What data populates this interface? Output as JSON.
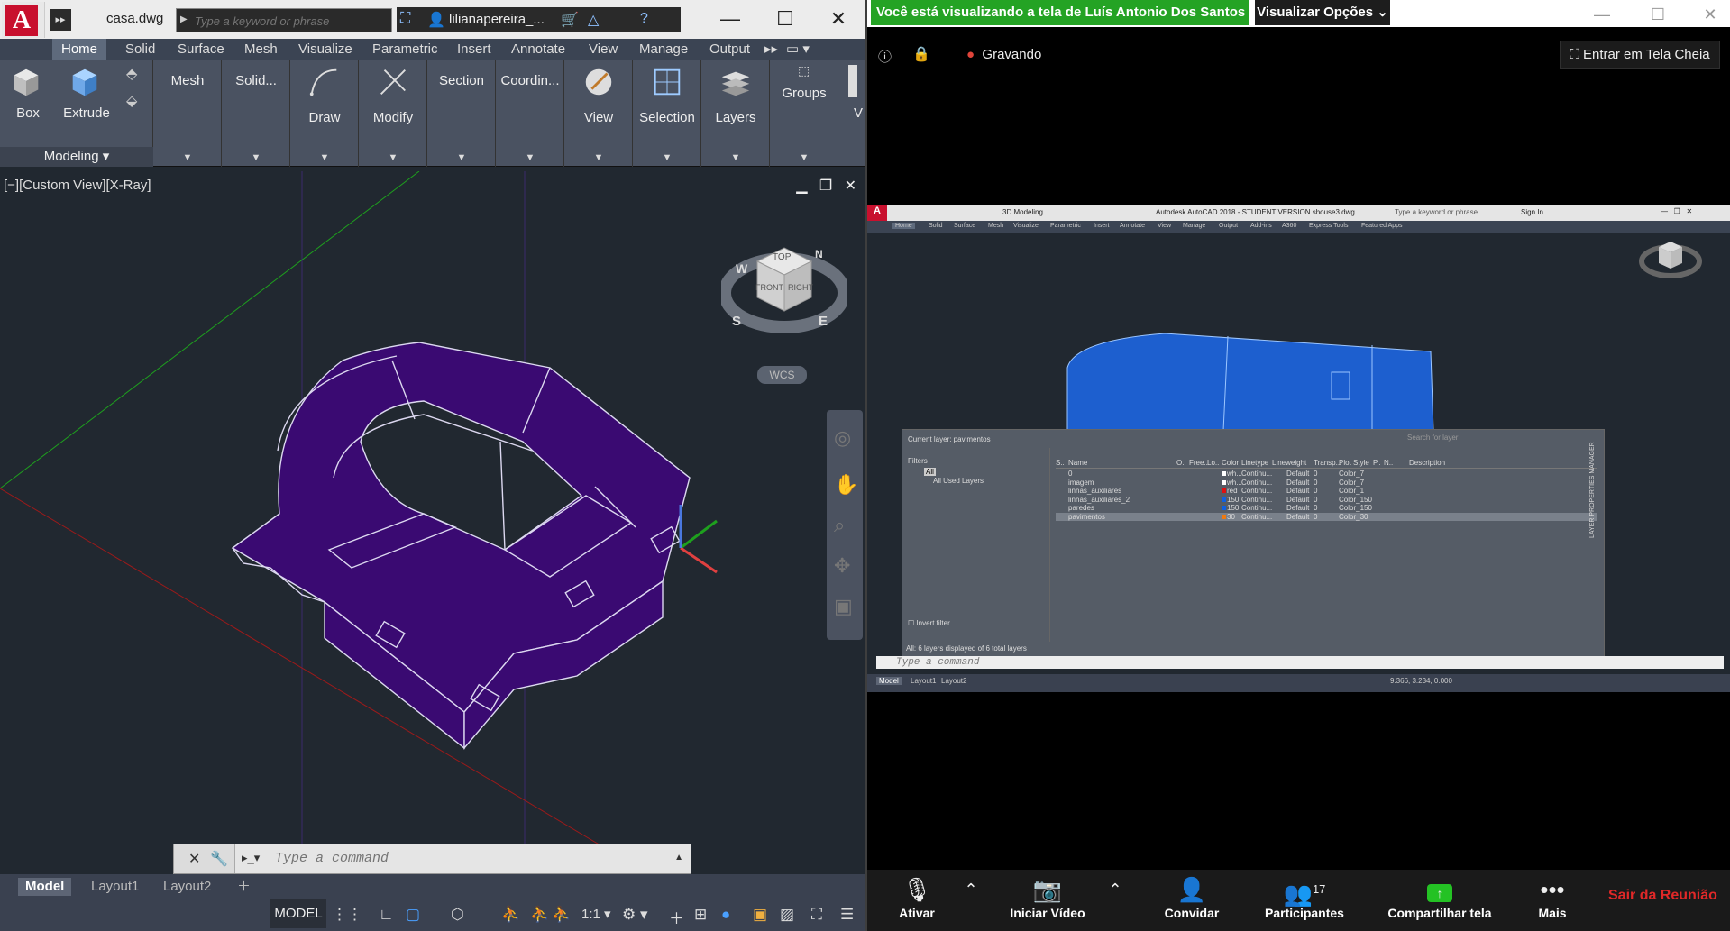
{
  "acad": {
    "file_name": "casa.dwg",
    "search_placeholder": "Type a keyword or phrase",
    "user_name": "lilianapereira_...",
    "tabs": [
      "Home",
      "Solid",
      "Surface",
      "Mesh",
      "Visualize",
      "Parametric",
      "Insert",
      "Annotate",
      "View",
      "Manage",
      "Output"
    ],
    "panels": {
      "box": "Box",
      "extrude": "Extrude",
      "modeling": "Modeling",
      "mesh": "Mesh",
      "solid": "Solid...",
      "draw": "Draw",
      "modify": "Modify",
      "section": "Section",
      "coordin": "Coordin...",
      "view": "View",
      "selection": "Selection",
      "layers": "Layers",
      "groups": "Groups"
    },
    "viewport_label": "[−][Custom View][X-Ray]",
    "viewcube": {
      "top": "TOP",
      "front": "FRONT",
      "right": "RIGHT",
      "compass_w": "W",
      "compass_s": "S",
      "compass_e": "E",
      "compass_n": "N"
    },
    "wcs": "WCS",
    "cmd_placeholder": "Type a command",
    "layout_tabs": [
      "Model",
      "Layout1",
      "Layout2"
    ],
    "status_model": "MODEL",
    "scale": "1:1",
    "model_color": "#3a0a72"
  },
  "zoom": {
    "banner": "Você está visualizando a tela de Luís Antonio Dos Santos o",
    "view_options": "Visualizar Opções",
    "recording": "Gravando",
    "fullscreen": "Entrar em Tela Cheia",
    "toolbar": {
      "mute": "Ativar",
      "video": "Iniciar Vídeo",
      "invite": "Convidar",
      "participants": "Participantes",
      "participants_count": "17",
      "share": "Compartilhar tela",
      "more": "Mais",
      "leave": "Sair da Reunião"
    }
  },
  "shared": {
    "workspace": "3D Modeling",
    "title": "Autodesk AutoCAD 2018 - STUDENT VERSION   shouse3.dwg",
    "search": "Type a keyword or phrase",
    "signin": "Sign In",
    "tabs": [
      "Home",
      "Solid",
      "Surface",
      "Mesh",
      "Visualize",
      "Parametric",
      "Insert",
      "Annotate",
      "View",
      "Manage",
      "Output",
      "Add-ins",
      "A360",
      "Express Tools",
      "Featured Apps"
    ],
    "layer_dialog": {
      "current_layer": "Current layer: pavimentos",
      "search_placeholder": "Search for layer",
      "filters": "Filters",
      "all": "All",
      "all_used": "All Used Layers",
      "invert_filter": "Invert filter",
      "footer": "All: 6 layers displayed of 6 total layers",
      "side_label": "LAYER PROPERTIES MANAGER",
      "columns": [
        "S..",
        "Name",
        "O..",
        "Free..",
        "Lo..",
        "Color",
        "Linetype",
        "Lineweight",
        "Transp...",
        "Plot Style",
        "P..",
        "N..",
        "Description"
      ],
      "rows": [
        {
          "name": "0",
          "color": "wh...",
          "linetype": "Continu...",
          "lineweight": "Default",
          "transp": "0",
          "plot": "Color_7"
        },
        {
          "name": "imagem",
          "color": "wh...",
          "linetype": "Continu...",
          "lineweight": "Default",
          "transp": "0",
          "plot": "Color_7"
        },
        {
          "name": "linhas_auxiliares",
          "color": "red",
          "linetype": "Continu...",
          "lineweight": "Default",
          "transp": "0",
          "plot": "Color_1"
        },
        {
          "name": "linhas_auxiliares_2",
          "color": "150",
          "linetype": "Continu...",
          "lineweight": "Default",
          "transp": "0",
          "plot": "Color_150"
        },
        {
          "name": "paredes",
          "color": "150",
          "linetype": "Continu...",
          "lineweight": "Default",
          "transp": "0",
          "plot": "Color_150"
        },
        {
          "name": "pavimentos",
          "color": "30",
          "linetype": "Continu...",
          "lineweight": "Default",
          "transp": "0",
          "plot": "Color_30"
        }
      ]
    },
    "cmd_placeholder": "Type a command",
    "coords": "9.366, 3.234, 0.000",
    "layout_tabs": [
      "Model",
      "Layout1",
      "Layout2"
    ],
    "model_color": "#1d5fcf"
  }
}
